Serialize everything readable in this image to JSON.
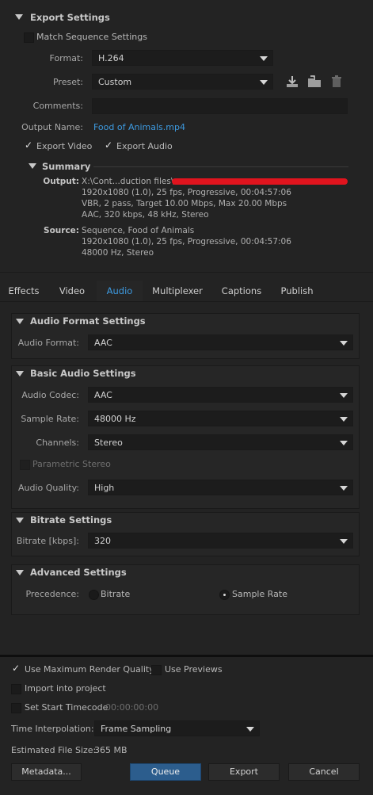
{
  "export_settings": {
    "title": "Export Settings",
    "match_sequence_label": "Match Sequence Settings",
    "match_sequence_checked": false,
    "format_label": "Format:",
    "format_value": "H.264",
    "preset_label": "Preset:",
    "preset_value": "Custom",
    "comments_label": "Comments:",
    "comments_value": "",
    "output_name_label": "Output Name:",
    "output_name_value": "Food of Animals.mp4",
    "export_video_label": "Export Video",
    "export_audio_label": "Export Audio",
    "export_video_checked": true,
    "export_audio_checked": true,
    "icons": [
      "save-preset-icon",
      "import-preset-icon",
      "delete-preset-icon"
    ]
  },
  "summary": {
    "title": "Summary",
    "output_key": "Output:",
    "output_lines": [
      "X:\\Cont...duction files\\",
      "1920x1080 (1.0), 25 fps, Progressive, 00:04:57:06",
      "VBR, 2 pass, Target 10.00 Mbps, Max 20.00 Mbps",
      "AAC, 320 kbps, 48 kHz, Stereo"
    ],
    "source_key": "Source:",
    "source_lines": [
      "Sequence, Food of Animals",
      "1920x1080 (1.0), 25 fps, Progressive, 00:04:57:06",
      "48000 Hz, Stereo"
    ]
  },
  "tabs": [
    {
      "label": "Effects",
      "active": false
    },
    {
      "label": "Video",
      "active": false
    },
    {
      "label": "Audio",
      "active": true
    },
    {
      "label": "Multiplexer",
      "active": false
    },
    {
      "label": "Captions",
      "active": false
    },
    {
      "label": "Publish",
      "active": false
    }
  ],
  "audio_format": {
    "title": "Audio Format Settings",
    "format_label": "Audio Format:",
    "format_value": "AAC"
  },
  "basic_audio": {
    "title": "Basic Audio Settings",
    "codec_label": "Audio Codec:",
    "codec_value": "AAC",
    "sample_rate_label": "Sample Rate:",
    "sample_rate_value": "48000 Hz",
    "channels_label": "Channels:",
    "channels_value": "Stereo",
    "parametric_stereo_label": "Parametric Stereo",
    "parametric_stereo_checked": false,
    "quality_label": "Audio Quality:",
    "quality_value": "High"
  },
  "bitrate": {
    "title": "Bitrate Settings",
    "label": "Bitrate [kbps]:",
    "value": "320"
  },
  "advanced": {
    "title": "Advanced Settings",
    "precedence_label": "Precedence:",
    "option_bitrate": "Bitrate",
    "option_sample_rate": "Sample Rate",
    "selected": "Sample Rate"
  },
  "footer": {
    "max_render_label": "Use Maximum Render Quality",
    "max_render_checked": true,
    "use_previews_label": "Use Previews",
    "use_previews_checked": false,
    "import_project_label": "Import into project",
    "import_project_checked": false,
    "start_timecode_label": "Set Start Timecode",
    "start_timecode_checked": false,
    "start_timecode_value": "00:00:00:00",
    "time_interp_label": "Time Interpolation:",
    "time_interp_value": "Frame Sampling",
    "file_size_label": "Estimated File Size:",
    "file_size_value": "365 MB",
    "metadata_button": "Metadata...",
    "queue_button": "Queue",
    "export_button": "Export",
    "cancel_button": "Cancel"
  },
  "colors": {
    "accent": "#3d9ae0",
    "redaction": "#e0141e",
    "primary_button": "#2c5d8d"
  }
}
